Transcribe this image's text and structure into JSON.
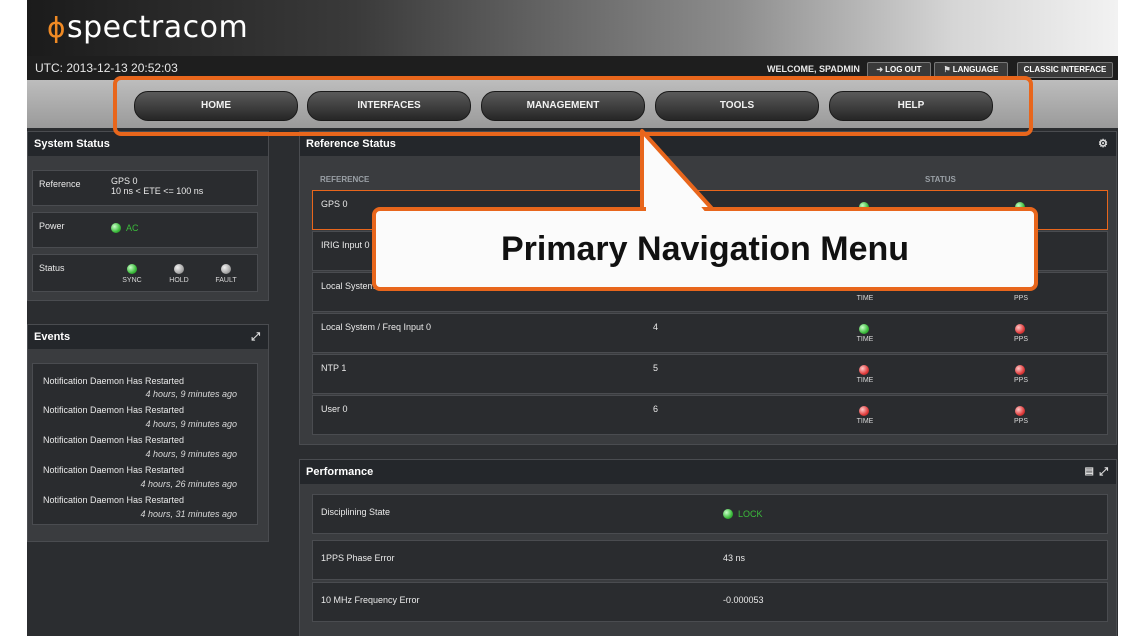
{
  "header": {
    "brand": "spectracom",
    "brand_symbol": "ɸ",
    "utc": "UTC: 2013-12-13 20:52:03",
    "welcome": "WELCOME, SPADMIN",
    "logout": "LOG OUT",
    "language": "LANGUAGE",
    "classic": "CLASSIC INTERFACE"
  },
  "nav": {
    "items": [
      "HOME",
      "INTERFACES",
      "MANAGEMENT",
      "TOOLS",
      "HELP"
    ]
  },
  "system_status": {
    "title": "System Status",
    "reference_label": "Reference",
    "reference_value": "GPS 0",
    "reference_detail": "10 ns < ETE <= 100 ns",
    "power_label": "Power",
    "power_value": "AC",
    "status_label": "Status",
    "indicators": [
      "SYNC",
      "HOLD",
      "FAULT"
    ]
  },
  "events": {
    "title": "Events",
    "items": [
      {
        "title": "Notification Daemon Has Restarted",
        "time": "4 hours, 9 minutes ago"
      },
      {
        "title": "Notification Daemon Has Restarted",
        "time": "4 hours, 9 minutes ago"
      },
      {
        "title": "Notification Daemon Has Restarted",
        "time": "4 hours, 9 minutes ago"
      },
      {
        "title": "Notification Daemon Has Restarted",
        "time": "4 hours, 26 minutes ago"
      },
      {
        "title": "Notification Daemon Has Restarted",
        "time": "4 hours, 31 minutes ago"
      }
    ]
  },
  "reference_status": {
    "title": "Reference Status",
    "col_reference": "REFERENCE",
    "col_status": "STATUS",
    "rows": [
      {
        "name": "GPS 0",
        "priority": "",
        "time": "",
        "pps": ""
      },
      {
        "name": "IRIG Input 0",
        "priority": "",
        "time": "",
        "pps": ""
      },
      {
        "name": "Local System",
        "priority": "",
        "time": "TIME",
        "pps": "PPS"
      },
      {
        "name": "Local System / Freq Input 0",
        "priority": "4",
        "time": "TIME",
        "pps": "PPS"
      },
      {
        "name": "NTP 1",
        "priority": "5",
        "time": "TIME",
        "pps": "PPS"
      },
      {
        "name": "User 0",
        "priority": "6",
        "time": "TIME",
        "pps": "PPS"
      }
    ]
  },
  "performance": {
    "title": "Performance",
    "rows": [
      {
        "label": "Disciplining State",
        "value": "LOCK"
      },
      {
        "label": "1PPS Phase Error",
        "value": "43 ns"
      },
      {
        "label": "10 MHz Frequency Error",
        "value": "-0.000053"
      }
    ]
  },
  "callout": {
    "text": "Primary Navigation Menu"
  },
  "colors": {
    "accent": "#e8661c",
    "green": "#3bbb3b",
    "red": "#e03b3b"
  }
}
